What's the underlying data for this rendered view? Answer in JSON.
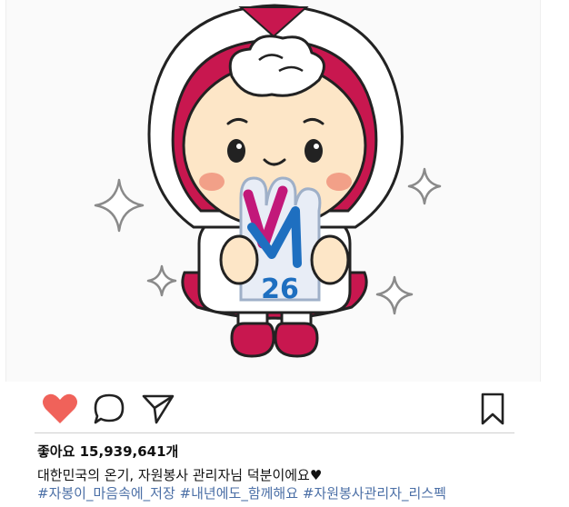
{
  "post": {
    "image_alt": "",
    "likes_label": "좋아요 15,939,641개",
    "caption": "대한민국의 온기, 자원봉사 관리자님 덕분이에요♥",
    "hashtags": [
      "#자봉이_마음속에_저장",
      "#내년에도_함께해요",
      "#자원봉사관리자_리스펙"
    ],
    "mascot_badge_text": "26"
  },
  "colors": {
    "like": "#f0625a",
    "hashtag": "#4b6fa6",
    "hood": "#c8174f",
    "badge_pink": "#c2187a",
    "badge_blue": "#1e6fc0"
  },
  "icons": {
    "like": "heart-icon",
    "comment": "speech-bubble-icon",
    "share": "paper-plane-icon",
    "save": "bookmark-icon"
  }
}
